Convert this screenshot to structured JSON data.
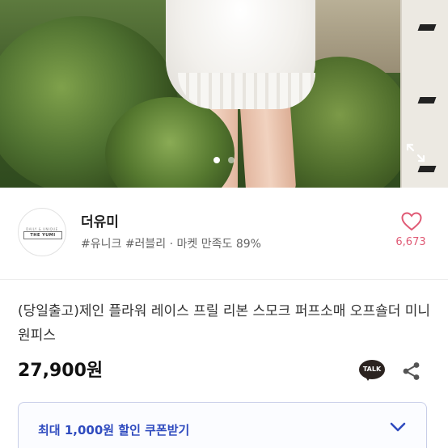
{
  "gallery": {
    "slide_count": 2,
    "active_index": 0
  },
  "shop": {
    "name": "더유미",
    "tags": "#유니크 #러블리 · 마켓 만족도 89%",
    "logo_top_text": "DAILY & UNIQUE",
    "logo_main_text": "THE YUMI",
    "like_count": "6,673"
  },
  "product": {
    "title": "(당일출고)제인 플라워 레이스 프릴 리본 스모크 퍼프소매 오프숄더 미니 원피스",
    "price": "27,900원"
  },
  "actions": {
    "talk_label": "TALK"
  },
  "coupon": {
    "label": "최대 1,000원 할인 쿠폰받기"
  },
  "colors": {
    "accent_blue": "#2f4bbf",
    "like_pink": "#e05a75",
    "coupon_border": "#c7cde8"
  },
  "icons": [
    "expand-icon",
    "heart-icon",
    "talk-icon",
    "share-icon",
    "chevron-down-icon"
  ]
}
